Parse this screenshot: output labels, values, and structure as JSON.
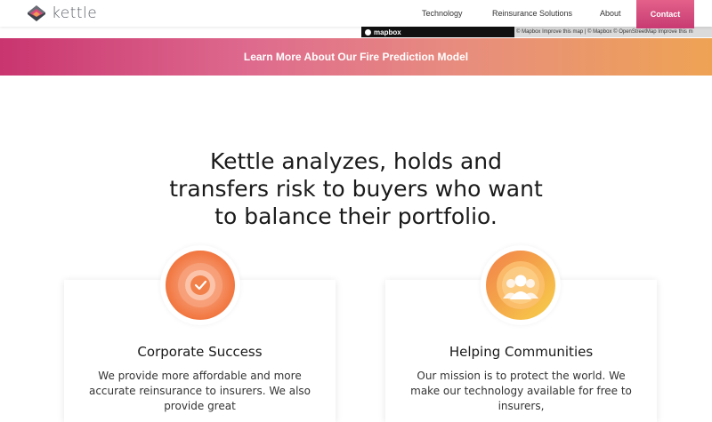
{
  "header": {
    "logo_text": "kettle",
    "nav": {
      "technology": "Technology",
      "reinsurance": "Reinsurance Solutions",
      "about": "About",
      "contact": "Contact"
    }
  },
  "map": {
    "logo_text": "mapbox",
    "attribution": "© Mapbox  Improve this map  | © Mapbox © OpenStreetMap  Improve this m"
  },
  "banner": {
    "text": "Learn More About Our Fire Prediction Model"
  },
  "headline": {
    "line1": "Kettle analyzes, holds and",
    "line2": "transfers risk to buyers who want",
    "line3": "to balance their portfolio."
  },
  "cards": [
    {
      "title": "Corporate Success",
      "body": "We provide more affordable and more accurate reinsurance to insurers. We also provide great",
      "icon": "checkmark-icon"
    },
    {
      "title": "Helping Communities",
      "body": "Our mission is to protect the world. We make our technology available for free to insurers,",
      "icon": "people-icon"
    }
  ],
  "colors": {
    "brand_pink": "#c9356f",
    "brand_orange": "#eea354",
    "icon_orange": "#f2804a",
    "icon_yellow": "#f7c948"
  }
}
